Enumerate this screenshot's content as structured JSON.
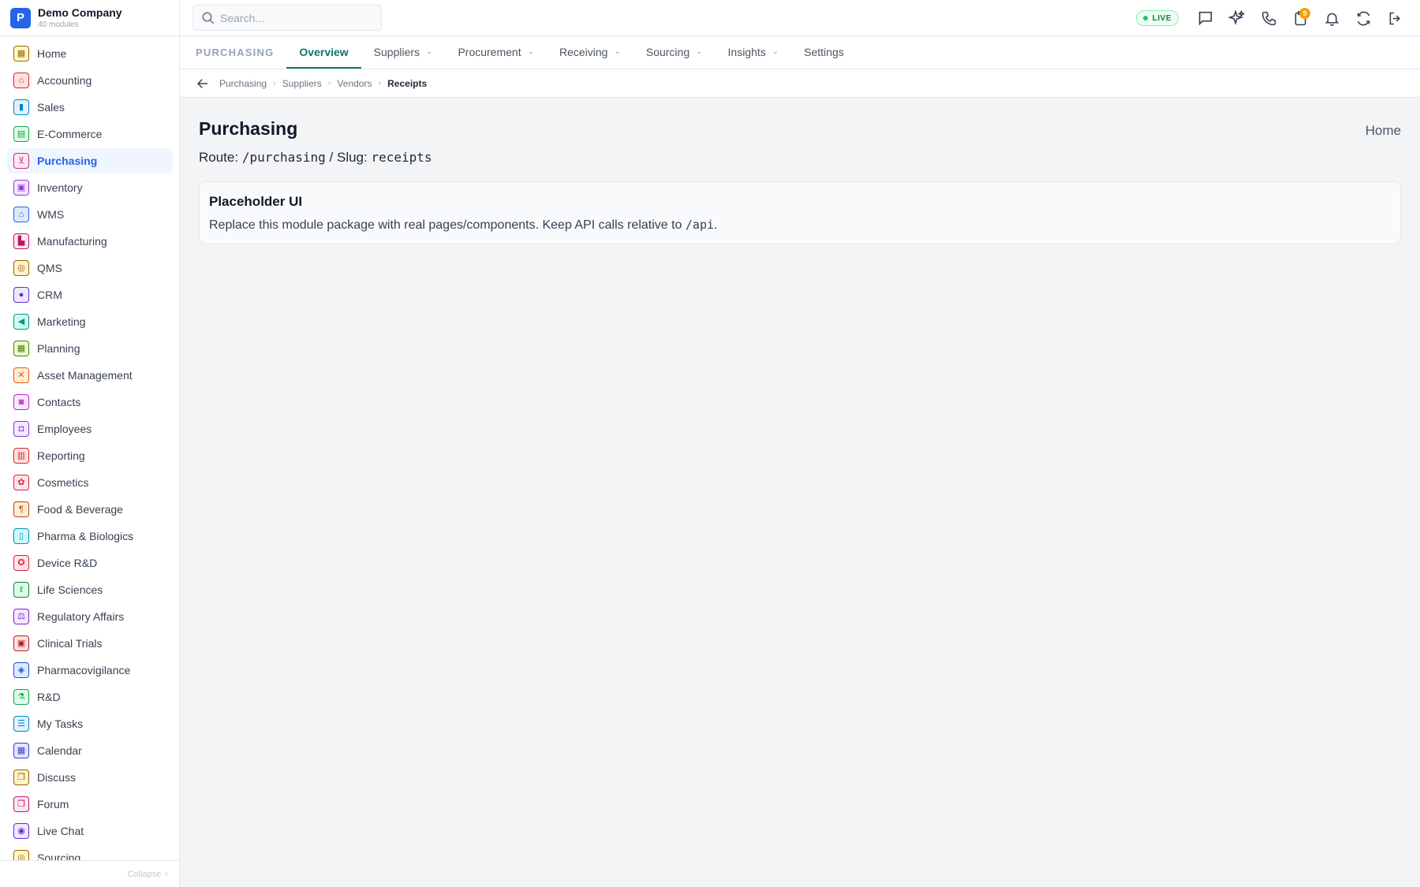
{
  "brand": {
    "initial": "P",
    "name": "Demo Company",
    "subtitle": "40 modules"
  },
  "sidebar": {
    "items": [
      {
        "label": "Home",
        "icon": "▦",
        "color": "#a16207",
        "bg": "#fef9c3",
        "name": "home"
      },
      {
        "label": "Accounting",
        "icon": "⌂",
        "color": "#dc2626",
        "bg": "#fee2e2",
        "name": "accounting"
      },
      {
        "label": "Sales",
        "icon": "▮",
        "color": "#0284c7",
        "bg": "#e0f2fe",
        "name": "sales"
      },
      {
        "label": "E-Commerce",
        "icon": "▤",
        "color": "#16a34a",
        "bg": "#dcfce7",
        "name": "e-commerce"
      },
      {
        "label": "Purchasing",
        "icon": "⊻",
        "color": "#db2777",
        "bg": "#fce7f3",
        "name": "purchasing"
      },
      {
        "label": "Inventory",
        "icon": "▣",
        "color": "#9333ea",
        "bg": "#f3e8ff",
        "name": "inventory"
      },
      {
        "label": "WMS",
        "icon": "⌂",
        "color": "#2563eb",
        "bg": "#dbeafe",
        "name": "wms"
      },
      {
        "label": "Manufacturing",
        "icon": "▙",
        "color": "#be185d",
        "bg": "#fce7f3",
        "name": "manufacturing"
      },
      {
        "label": "QMS",
        "icon": "◎",
        "color": "#a16207",
        "bg": "#fef3c7",
        "name": "qms"
      },
      {
        "label": "CRM",
        "icon": "●",
        "color": "#6d28d9",
        "bg": "#ede9fe",
        "name": "crm"
      },
      {
        "label": "Marketing",
        "icon": "◀",
        "color": "#0d9488",
        "bg": "#ccfbf1",
        "name": "marketing"
      },
      {
        "label": "Planning",
        "icon": "▦",
        "color": "#4d7c0f",
        "bg": "#ecfccb",
        "name": "planning"
      },
      {
        "label": "Asset Management",
        "icon": "✕",
        "color": "#ea580c",
        "bg": "#ffedd5",
        "name": "asset-management"
      },
      {
        "label": "Contacts",
        "icon": "◙",
        "color": "#c026d3",
        "bg": "#fae8ff",
        "name": "contacts"
      },
      {
        "label": "Employees",
        "icon": "◘",
        "color": "#9333ea",
        "bg": "#f3e8ff",
        "name": "employees"
      },
      {
        "label": "Reporting",
        "icon": "▥",
        "color": "#dc2626",
        "bg": "#fee2e2",
        "name": "reporting"
      },
      {
        "label": "Cosmetics",
        "icon": "✿",
        "color": "#e11d48",
        "bg": "#ffe4e6",
        "name": "cosmetics"
      },
      {
        "label": "Food & Beverage",
        "icon": "¶",
        "color": "#c2410c",
        "bg": "#ffedd5",
        "name": "food-beverage"
      },
      {
        "label": "Pharma & Biologics",
        "icon": "▯",
        "color": "#0891b2",
        "bg": "#cffafe",
        "name": "pharma-biologics"
      },
      {
        "label": "Device R&D",
        "icon": "✪",
        "color": "#e11d48",
        "bg": "#ffe4e6",
        "name": "device-rd"
      },
      {
        "label": "Life Sciences",
        "icon": "ℓ",
        "color": "#15803d",
        "bg": "#dcfce7",
        "name": "life-sciences"
      },
      {
        "label": "Regulatory Affairs",
        "icon": "⚖",
        "color": "#7e22ce",
        "bg": "#f3e8ff",
        "name": "regulatory-affairs"
      },
      {
        "label": "Clinical Trials",
        "icon": "▣",
        "color": "#b91c1c",
        "bg": "#fee2e2",
        "name": "clinical-trials"
      },
      {
        "label": "Pharmacovigilance",
        "icon": "◈",
        "color": "#1d4ed8",
        "bg": "#dbeafe",
        "name": "pharmacovigilance"
      },
      {
        "label": "R&D",
        "icon": "⚗",
        "color": "#16a34a",
        "bg": "#dcfce7",
        "name": "rd"
      },
      {
        "label": "My Tasks",
        "icon": "☰",
        "color": "#0284c7",
        "bg": "#e0f2fe",
        "name": "my-tasks"
      },
      {
        "label": "Calendar",
        "icon": "▦",
        "color": "#4338ca",
        "bg": "#e0e7ff",
        "name": "calendar"
      },
      {
        "label": "Discuss",
        "icon": "❐",
        "color": "#a16207",
        "bg": "#fef3c7",
        "name": "discuss"
      },
      {
        "label": "Forum",
        "icon": "❐",
        "color": "#be185d",
        "bg": "#fce7f3",
        "name": "forum"
      },
      {
        "label": "Live Chat",
        "icon": "◉",
        "color": "#6d28d9",
        "bg": "#ede9fe",
        "name": "live-chat"
      },
      {
        "label": "Sourcing",
        "icon": "◎",
        "color": "#a16207",
        "bg": "#fef9c3",
        "name": "sourcing"
      }
    ],
    "active": "Purchasing",
    "collapse_label": "Collapse"
  },
  "search": {
    "placeholder": "Search...",
    "value": ""
  },
  "topbar": {
    "live_label": "LIVE",
    "tasks_badge": "9"
  },
  "module_nav": {
    "label": "PURCHASING",
    "tabs": [
      {
        "label": "Overview",
        "dropdown": false,
        "active": true
      },
      {
        "label": "Suppliers",
        "dropdown": true,
        "active": false
      },
      {
        "label": "Procurement",
        "dropdown": true,
        "active": false
      },
      {
        "label": "Receiving",
        "dropdown": true,
        "active": false
      },
      {
        "label": "Sourcing",
        "dropdown": true,
        "active": false
      },
      {
        "label": "Insights",
        "dropdown": true,
        "active": false
      },
      {
        "label": "Settings",
        "dropdown": false,
        "active": false
      }
    ]
  },
  "breadcrumb": [
    "Purchasing",
    "Suppliers",
    "Vendors",
    "Receipts"
  ],
  "page": {
    "title": "Purchasing",
    "home_link": "Home",
    "route_prefix": "Route:",
    "route_value": "/purchasing",
    "slug_prefix": "/ Slug:",
    "slug_value": "receipts"
  },
  "card": {
    "title": "Placeholder UI",
    "body_text": "Replace this module package with real pages/components. Keep API calls relative to",
    "body_code": "/api",
    "body_end": "."
  },
  "colors": {
    "accent": "#0f766e",
    "brand": "#2563eb",
    "live": "#22c55e",
    "badge": "#f59e0b"
  }
}
